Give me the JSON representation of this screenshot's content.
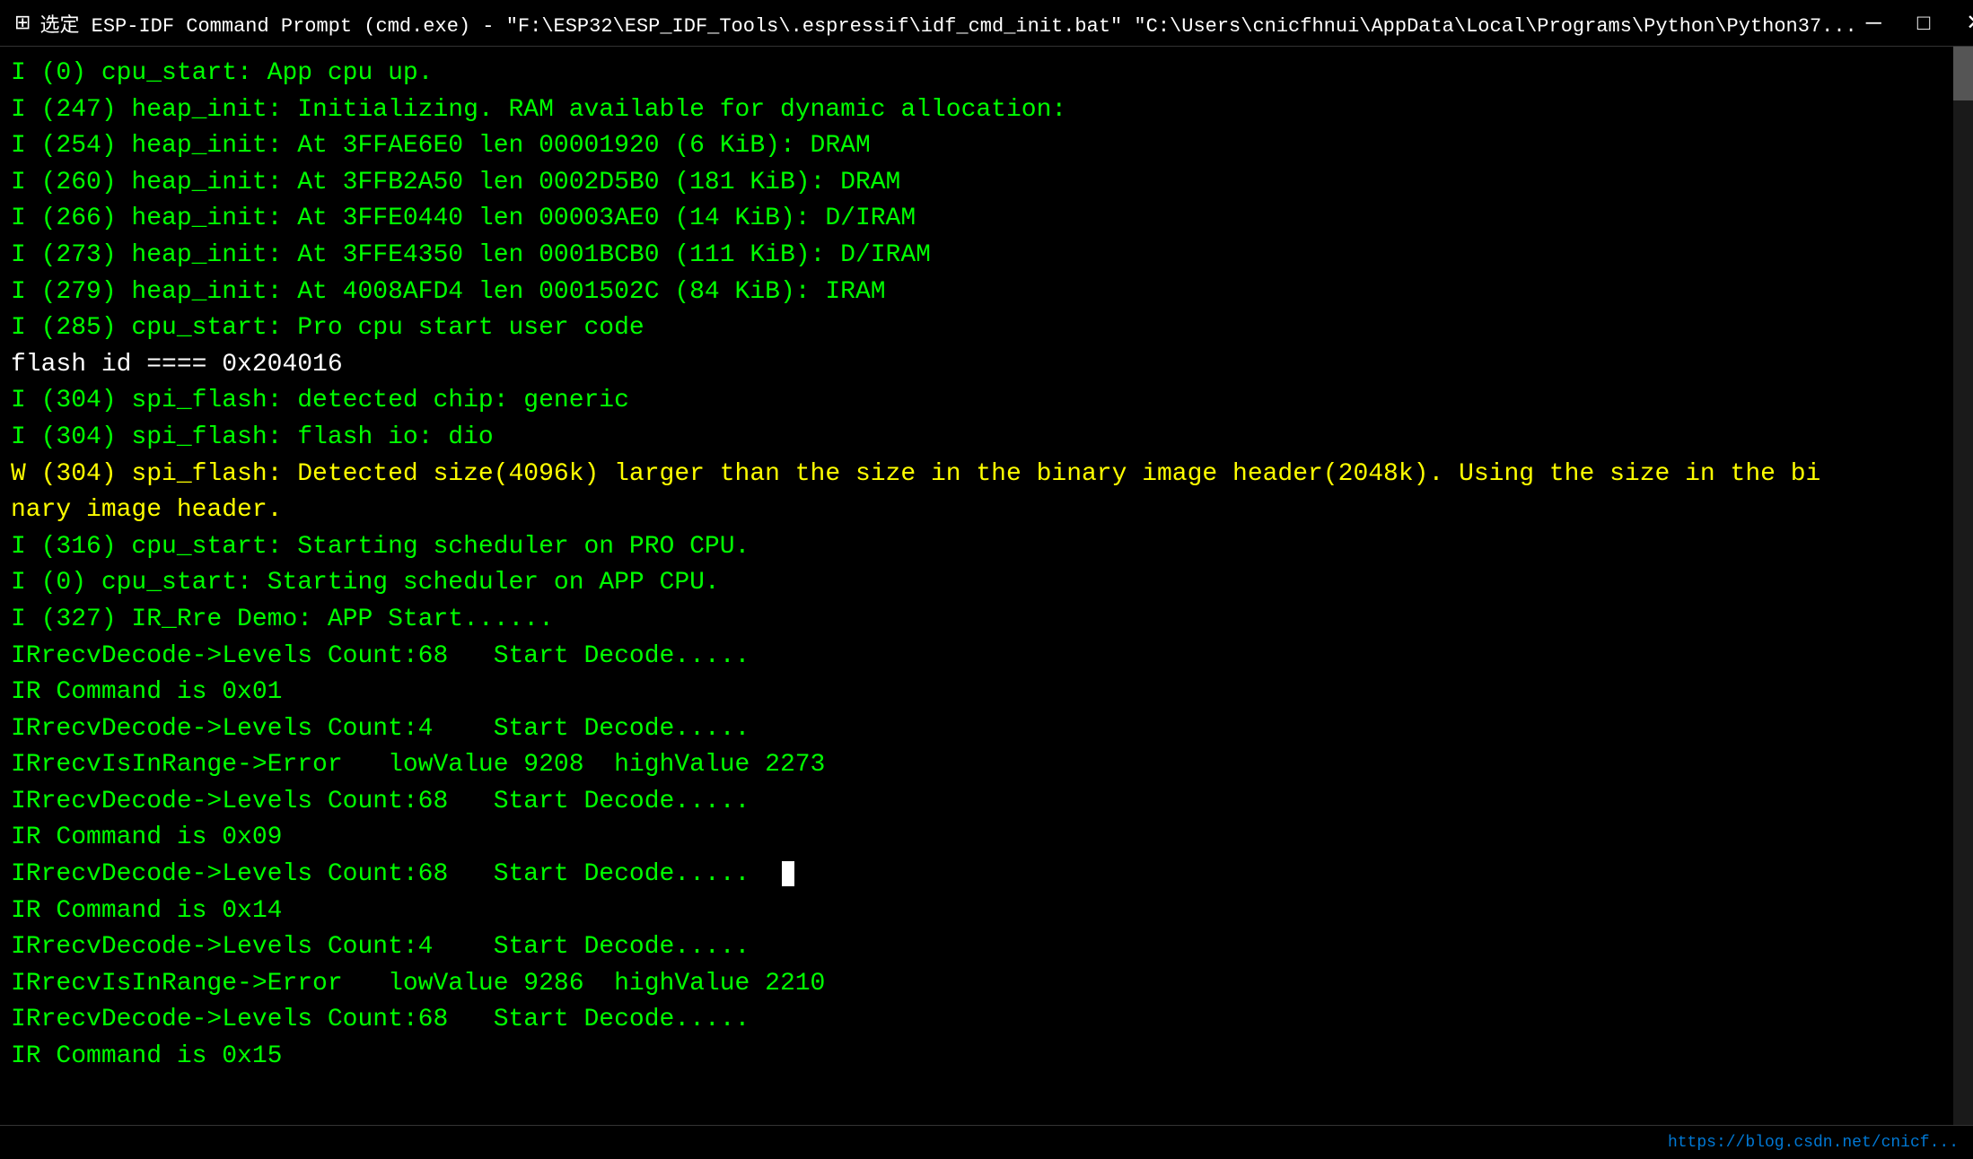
{
  "titlebar": {
    "icon": "⊞",
    "text": "选定 ESP-IDF Command Prompt (cmd.exe) - \"F:\\ESP32\\ESP_IDF_Tools\\.espressif\\idf_cmd_init.bat\" \"C:\\Users\\cnicfhnui\\AppData\\Local\\Programs\\Python\\Python37...",
    "minimize_label": "─",
    "maximize_label": "□",
    "close_label": "✕"
  },
  "terminal": {
    "lines": [
      {
        "type": "normal",
        "text": "I (0) cpu_start: App cpu up."
      },
      {
        "type": "normal",
        "text": "I (247) heap_init: Initializing. RAM available for dynamic allocation:"
      },
      {
        "type": "normal",
        "text": "I (254) heap_init: At 3FFAE6E0 len 00001920 (6 KiB): DRAM"
      },
      {
        "type": "normal",
        "text": "I (260) heap_init: At 3FFB2A50 len 0002D5B0 (181 KiB): DRAM"
      },
      {
        "type": "normal",
        "text": "I (266) heap_init: At 3FFE0440 len 00003AE0 (14 KiB): D/IRAM"
      },
      {
        "type": "normal",
        "text": "I (273) heap_init: At 3FFE4350 len 0001BCB0 (111 KiB): D/IRAM"
      },
      {
        "type": "normal",
        "text": "I (279) heap_init: At 4008AFD4 len 0001502C (84 KiB): IRAM"
      },
      {
        "type": "normal",
        "text": "I (285) cpu_start: Pro cpu start user code"
      },
      {
        "type": "white",
        "text": "flash id ==== 0x204016"
      },
      {
        "type": "normal",
        "text": "I (304) spi_flash: detected chip: generic"
      },
      {
        "type": "normal",
        "text": "I (304) spi_flash: flash io: dio"
      },
      {
        "type": "warning",
        "text": "W (304) spi_flash: Detected size(4096k) larger than the size in the binary image header(2048k). Using the size in the bi"
      },
      {
        "type": "warning",
        "text": "nary image header."
      },
      {
        "type": "normal",
        "text": "I (316) cpu_start: Starting scheduler on PRO CPU."
      },
      {
        "type": "normal",
        "text": "I (0) cpu_start: Starting scheduler on APP CPU."
      },
      {
        "type": "normal",
        "text": "I (327) IR_Rre Demo: APP Start......"
      },
      {
        "type": "normal",
        "text": "IRrecvDecode->Levels Count:68   Start Decode....."
      },
      {
        "type": "normal",
        "text": "IR Command is 0x01"
      },
      {
        "type": "normal",
        "text": "IRrecvDecode->Levels Count:4    Start Decode....."
      },
      {
        "type": "normal",
        "text": "IRrecvIsInRange->Error   lowValue 9208  highValue 2273"
      },
      {
        "type": "normal",
        "text": "IRrecvDecode->Levels Count:68   Start Decode....."
      },
      {
        "type": "normal",
        "text": "IR Command is 0x09"
      },
      {
        "type": "normal",
        "text": "IRrecvDecode->Levels Count:68   Start Decode.....  ",
        "cursor": true
      },
      {
        "type": "normal",
        "text": "IR Command is 0x14"
      },
      {
        "type": "normal",
        "text": "IRrecvDecode->Levels Count:4    Start Decode....."
      },
      {
        "type": "normal",
        "text": "IRrecvIsInRange->Error   lowValue 9286  highValue 2210"
      },
      {
        "type": "normal",
        "text": "IRrecvDecode->Levels Count:68   Start Decode....."
      },
      {
        "type": "normal",
        "text": "IR Command is 0x15"
      }
    ]
  },
  "statusbar": {
    "text": "https://blog.csdn.net/cnicf..."
  }
}
